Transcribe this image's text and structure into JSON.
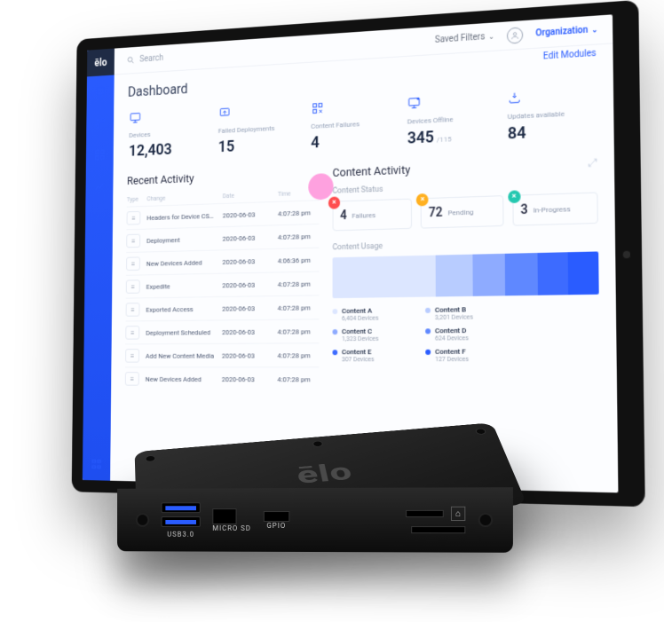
{
  "brand": "ēlo",
  "topbar": {
    "search_placeholder": "Search",
    "saved_filters": "Saved Filters",
    "organization": "Organization"
  },
  "page_title": "Dashboard",
  "edit_modules": "Edit Modules",
  "kpis": [
    {
      "label": "Devices",
      "value": "12,403",
      "sub": ""
    },
    {
      "label": "Failed Deployments",
      "value": "15",
      "sub": ""
    },
    {
      "label": "Content Failures",
      "value": "4",
      "sub": ""
    },
    {
      "label": "Devices Offline",
      "value": "345",
      "sub": "/115"
    },
    {
      "label": "Updates available",
      "value": "84",
      "sub": ""
    }
  ],
  "recent_activity": {
    "title": "Recent Activity",
    "columns": [
      "Type",
      "Change",
      "Date",
      "Time"
    ],
    "rows": [
      {
        "name": "Headers for Device CSV Expo…",
        "date": "2020-06-03",
        "time": "4:07:28 pm"
      },
      {
        "name": "Deployment",
        "date": "2020-06-03",
        "time": "4:07:28 pm"
      },
      {
        "name": "New Devices Added",
        "date": "2020-06-03",
        "time": "4:06:36 pm"
      },
      {
        "name": "Expedite",
        "date": "2020-06-03",
        "time": "4:07:28 pm"
      },
      {
        "name": "Exported Access",
        "date": "2020-06-03",
        "time": "4:07:28 pm"
      },
      {
        "name": "Deployment Scheduled",
        "date": "2020-06-03",
        "time": "4:07:28 pm"
      },
      {
        "name": "Add New Content Media",
        "date": "2020-06-03",
        "time": "4:07:28 pm"
      },
      {
        "name": "New Devices Added",
        "date": "2020-06-03",
        "time": "4:07:28 pm"
      }
    ]
  },
  "content_activity": {
    "title": "Content Activity",
    "status_label": "Content Status",
    "status": [
      {
        "value": "4",
        "label": "Failures",
        "color": "#ff4d4f"
      },
      {
        "value": "72",
        "label": "Pending",
        "color": "#ffb020"
      },
      {
        "value": "3",
        "label": "In-Progress",
        "color": "#24c8b0"
      }
    ],
    "usage_label": "Content Usage",
    "usage_segments": [
      {
        "key": "a",
        "pct": 40,
        "color": "#dce6ff"
      },
      {
        "key": "b",
        "pct": 14,
        "color": "#b8ccff"
      },
      {
        "key": "c",
        "pct": 12,
        "color": "#8eabff"
      },
      {
        "key": "d",
        "pct": 12,
        "color": "#5f88ff"
      },
      {
        "key": "e",
        "pct": 11,
        "color": "#3d6bff"
      },
      {
        "key": "f",
        "pct": 11,
        "color": "#2a5cff"
      }
    ],
    "legend": [
      {
        "name": "Content A",
        "sub": "6,404 Devices",
        "color": "#dce6ff"
      },
      {
        "name": "Content B",
        "sub": "3,201 Devices",
        "color": "#b8ccff"
      },
      {
        "name": "Content C",
        "sub": "1,323 Devices",
        "color": "#8eabff"
      },
      {
        "name": "Content D",
        "sub": "624 Devices",
        "color": "#5f88ff"
      },
      {
        "name": "Content E",
        "sub": "307 Devices",
        "color": "#3d6bff"
      },
      {
        "name": "Content F",
        "sub": "127 Devices",
        "color": "#2a5cff"
      }
    ]
  },
  "device": {
    "logo": "ēlo",
    "ports": {
      "usb": "USB3.0",
      "microsd": "MICRO SD",
      "gpio": "GPIO"
    }
  },
  "chart_data": {
    "type": "bar",
    "title": "Content Usage",
    "categories": [
      "Content A",
      "Content B",
      "Content C",
      "Content D",
      "Content E",
      "Content F"
    ],
    "values": [
      6404,
      3201,
      1323,
      624,
      307,
      127
    ],
    "xlabel": "",
    "ylabel": "Devices",
    "ylim": [
      0,
      6500
    ]
  }
}
